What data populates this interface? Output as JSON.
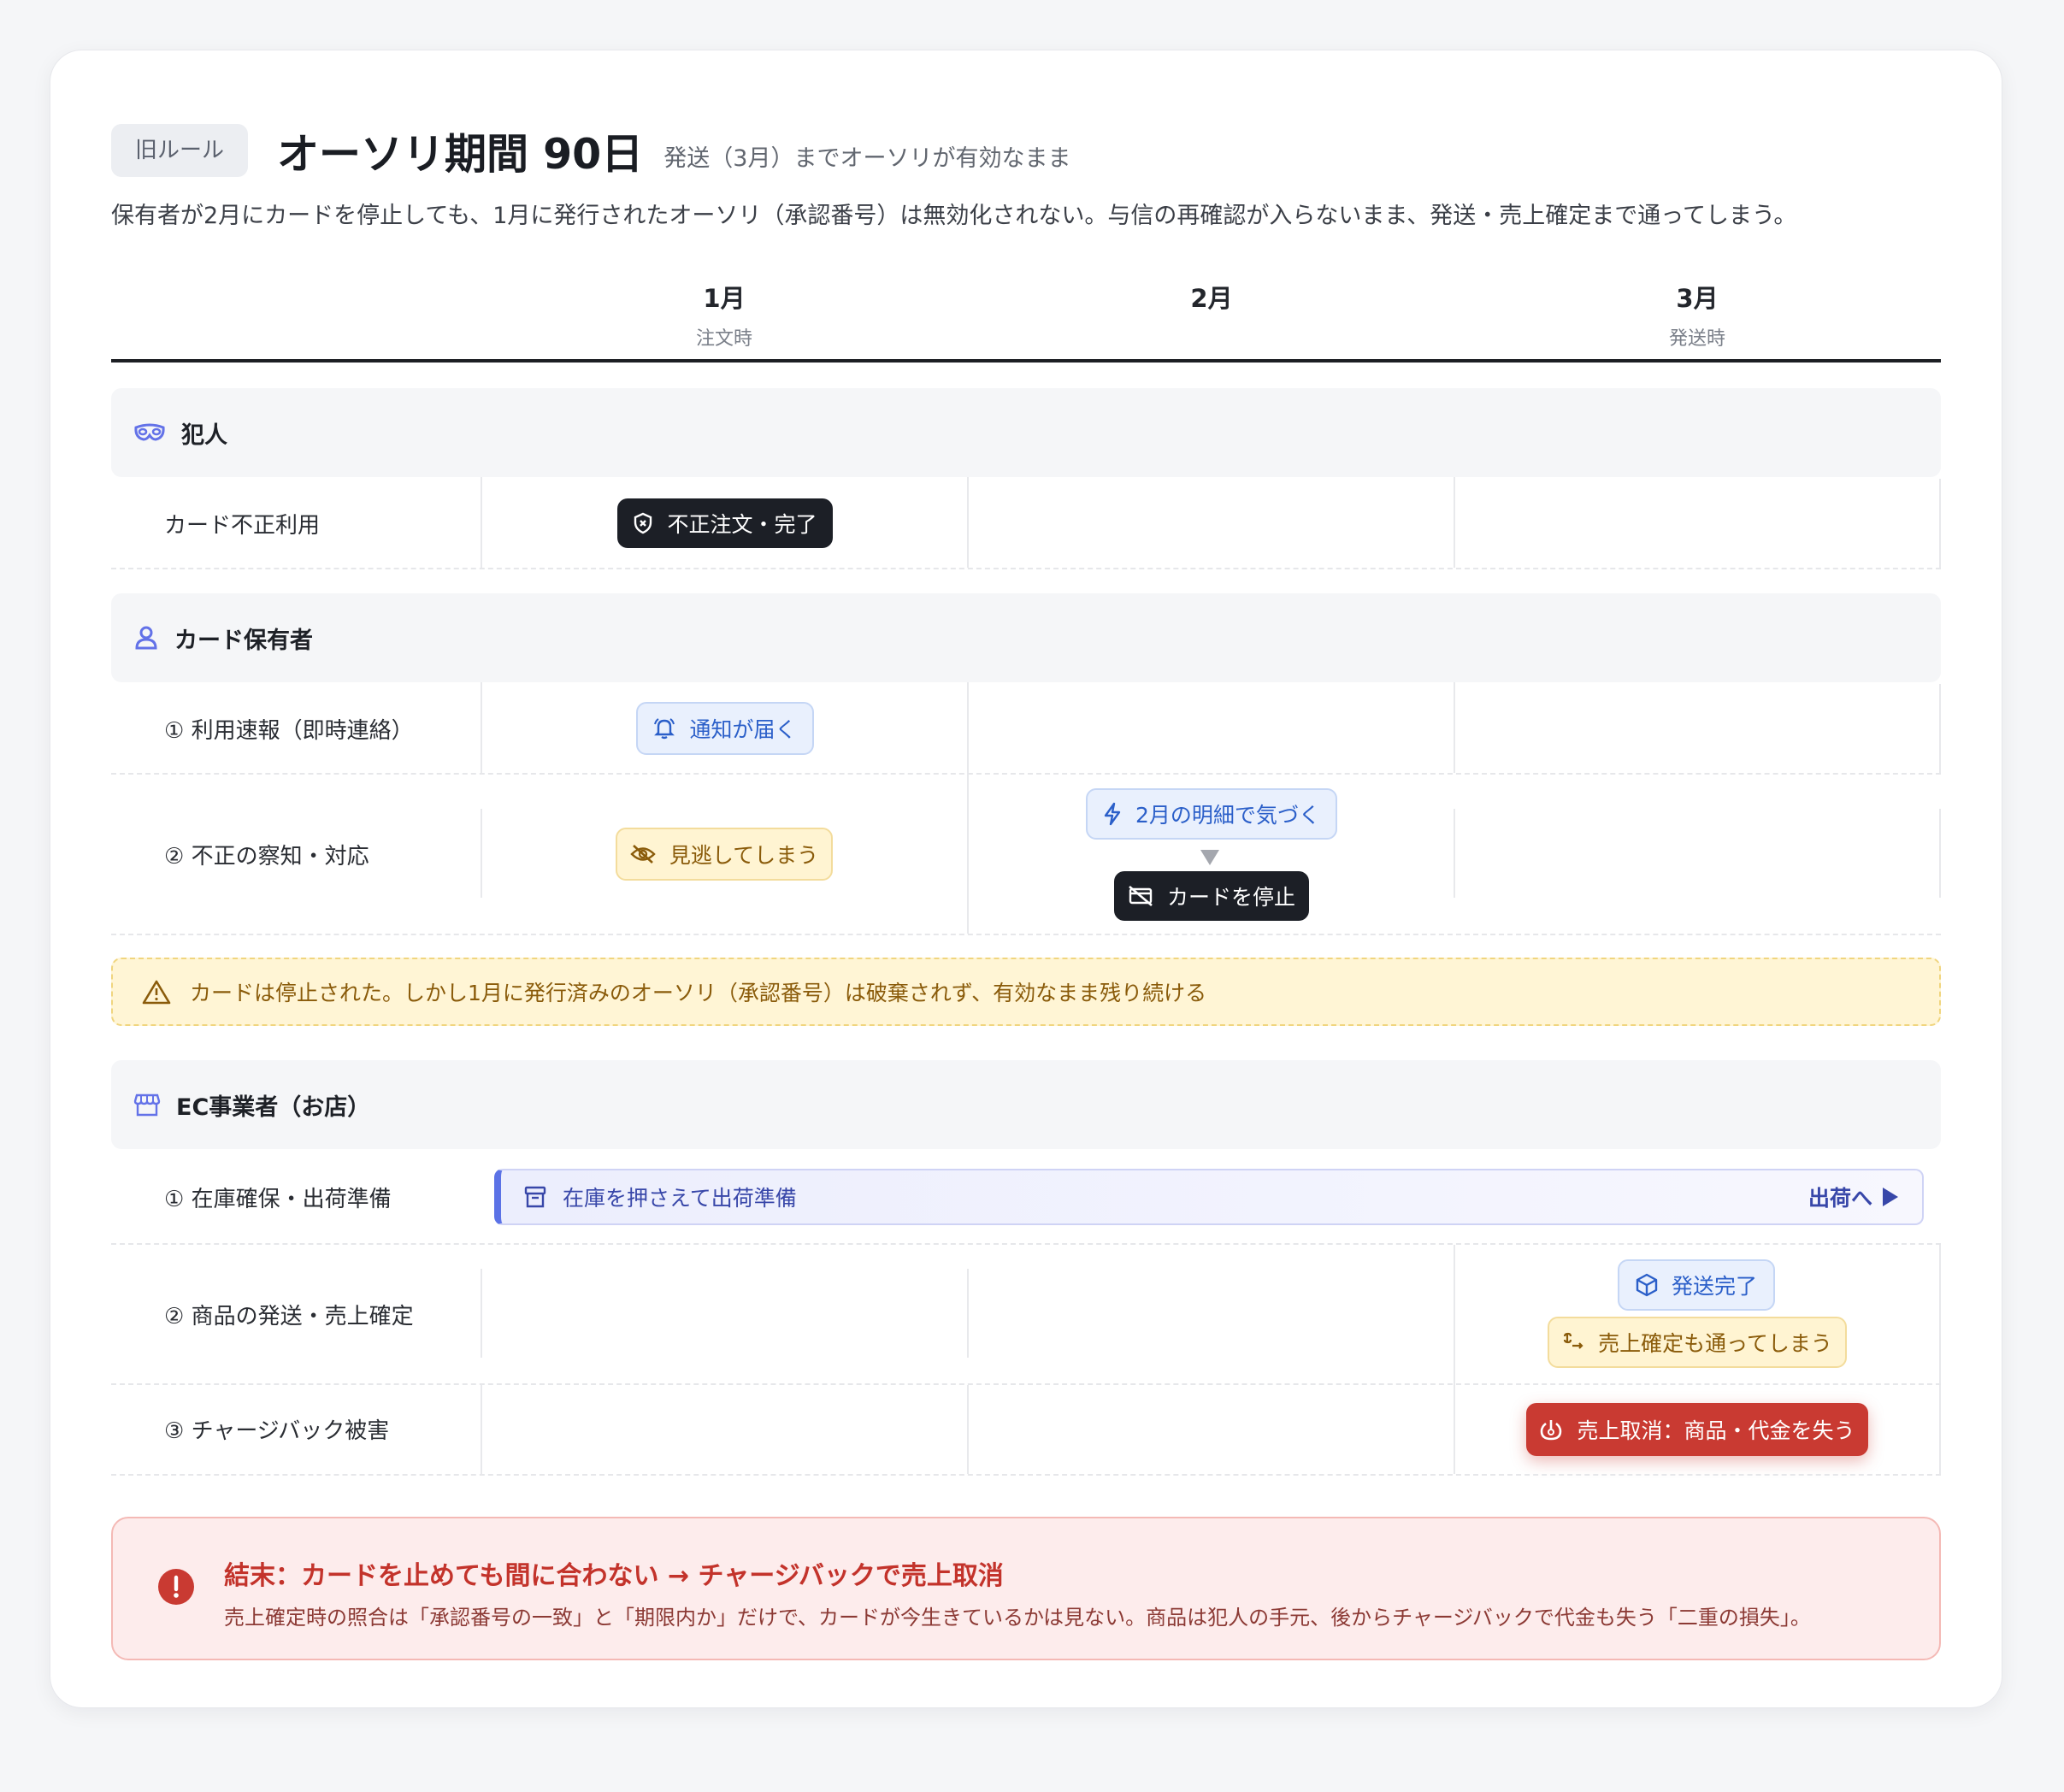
{
  "header": {
    "badge": "旧ルール",
    "title": "オーソリ期間 90日",
    "subtitle": "発送（3月）までオーソリが有効なまま"
  },
  "description": "保有者が2月にカードを停止しても、1月に発行されたオーソリ（承認番号）は無効化されない。与信の再確認が入らないまま、発送・売上確定まで通ってしまう。",
  "months": [
    {
      "label": "1月",
      "sub": "注文時"
    },
    {
      "label": "2月",
      "sub": ""
    },
    {
      "label": "3月",
      "sub": "発送時"
    }
  ],
  "groups": {
    "criminal": {
      "label": "犯人",
      "icon": "mask-icon",
      "rows": {
        "fraud": "カード不正利用"
      },
      "events": {
        "fraud_done": "不正注文・完了"
      }
    },
    "holder": {
      "label": "カード保有者",
      "icon": "user-icon",
      "rows": {
        "notify": "① 利用速報（即時連絡）",
        "detect": "② 不正の察知・対応"
      },
      "events": {
        "notified": "通知が届く",
        "missed": "見逃してしまう",
        "noticed": "2月の明細で気づく",
        "stopped": "カードを停止"
      }
    },
    "merchant": {
      "label": "EC事業者（お店）",
      "icon": "store-icon",
      "rows": {
        "stock": "① 在庫確保・出荷準備",
        "ship": "② 商品の発送・売上確定",
        "chargeback": "③ チャージバック被害"
      },
      "events": {
        "stock_bar": "在庫を押さえて出荷準備",
        "stock_bar_end": "出荷へ",
        "shipped": "発送完了",
        "settled": "売上確定も通ってしまう",
        "cancelled": "売上取消：商品・代金を失う"
      }
    }
  },
  "warning": "カードは停止された。しかし1月に発行済みのオーソリ（承認番号）は破棄されず、有効なまま残り続ける",
  "result": {
    "title": "結末：カードを止めても間に合わない → チャージバックで売上取消",
    "detail": "売上確定時の照合は「承認番号の一致」と「期限内か」だけで、カードが今生きているかは見ない。商品は犯人の手元、後からチャージバックで代金も失う「二重の損失」。"
  },
  "colors": {
    "accent": "#5b72e6",
    "danger": "#c93a32",
    "warning_bg": "#fff5d5",
    "info_bg": "#e9f0fd"
  }
}
